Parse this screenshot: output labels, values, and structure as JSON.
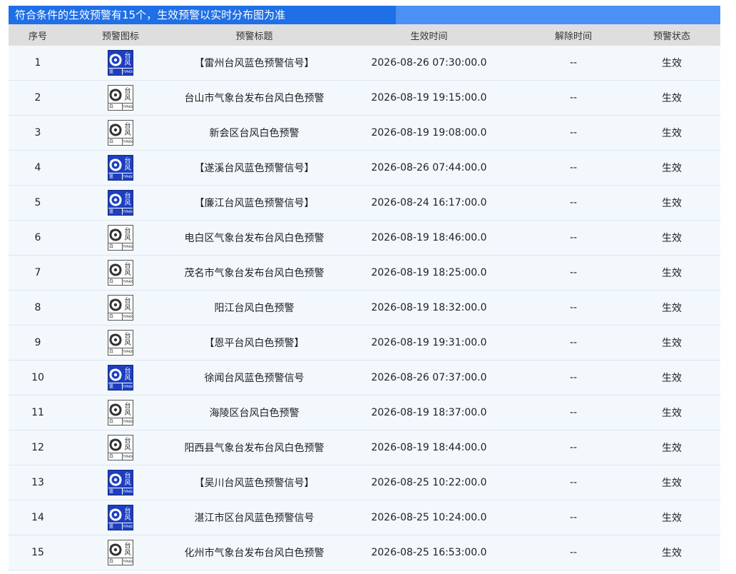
{
  "banner": {
    "text": "符合条件的生效预警有15个，生效预警以实时分布图为准"
  },
  "headers": [
    "序号",
    "预警图标",
    "预警标题",
    "生效时间",
    "解除时间",
    "预警状态"
  ],
  "icon_text": {
    "cn_top": "台",
    "cn_bottom": "风",
    "en": "TYPHOON"
  },
  "rows": [
    {
      "no": "1",
      "level": "蓝",
      "color": "blue",
      "title": "【雷州台风蓝色预警信号】",
      "start": "2026-08-26 07:30:00.0",
      "end": "--",
      "status": "生效"
    },
    {
      "no": "2",
      "level": "白",
      "color": "white",
      "title": "台山市气象台发布台风白色预警",
      "start": "2026-08-19 19:15:00.0",
      "end": "--",
      "status": "生效"
    },
    {
      "no": "3",
      "level": "白",
      "color": "white",
      "title": "新会区台风白色预警",
      "start": "2026-08-19 19:08:00.0",
      "end": "--",
      "status": "生效"
    },
    {
      "no": "4",
      "level": "蓝",
      "color": "blue",
      "title": "【遂溪台风蓝色预警信号】",
      "start": "2026-08-26 07:44:00.0",
      "end": "--",
      "status": "生效"
    },
    {
      "no": "5",
      "level": "蓝",
      "color": "blue",
      "title": "【廉江台风蓝色预警信号】",
      "start": "2026-08-24 16:17:00.0",
      "end": "--",
      "status": "生效"
    },
    {
      "no": "6",
      "level": "白",
      "color": "white",
      "title": "电白区气象台发布台风白色预警",
      "start": "2026-08-19 18:46:00.0",
      "end": "--",
      "status": "生效"
    },
    {
      "no": "7",
      "level": "白",
      "color": "white",
      "title": "茂名市气象台发布台风白色预警",
      "start": "2026-08-19 18:25:00.0",
      "end": "--",
      "status": "生效"
    },
    {
      "no": "8",
      "level": "白",
      "color": "white",
      "title": "阳江台风白色预警",
      "start": "2026-08-19 18:32:00.0",
      "end": "--",
      "status": "生效"
    },
    {
      "no": "9",
      "level": "白",
      "color": "white",
      "title": "【恩平台风白色预警】",
      "start": "2026-08-19 19:31:00.0",
      "end": "--",
      "status": "生效"
    },
    {
      "no": "10",
      "level": "蓝",
      "color": "blue",
      "title": "徐闻台风蓝色预警信号",
      "start": "2026-08-26 07:37:00.0",
      "end": "--",
      "status": "生效"
    },
    {
      "no": "11",
      "level": "白",
      "color": "white",
      "title": "海陵区台风白色预警",
      "start": "2026-08-19 18:37:00.0",
      "end": "--",
      "status": "生效"
    },
    {
      "no": "12",
      "level": "白",
      "color": "white",
      "title": "阳西县气象台发布台风白色预警",
      "start": "2026-08-19 18:44:00.0",
      "end": "--",
      "status": "生效"
    },
    {
      "no": "13",
      "level": "蓝",
      "color": "blue",
      "title": "【吴川台风蓝色预警信号】",
      "start": "2026-08-25 10:22:00.0",
      "end": "--",
      "status": "生效"
    },
    {
      "no": "14",
      "level": "蓝",
      "color": "blue",
      "title": "湛江市区台风蓝色预警信号",
      "start": "2026-08-25 10:24:00.0",
      "end": "--",
      "status": "生效"
    },
    {
      "no": "15",
      "level": "白",
      "color": "white",
      "title": "化州市气象台发布台风白色预警",
      "start": "2026-08-25 16:53:00.0",
      "end": "--",
      "status": "生效"
    }
  ]
}
